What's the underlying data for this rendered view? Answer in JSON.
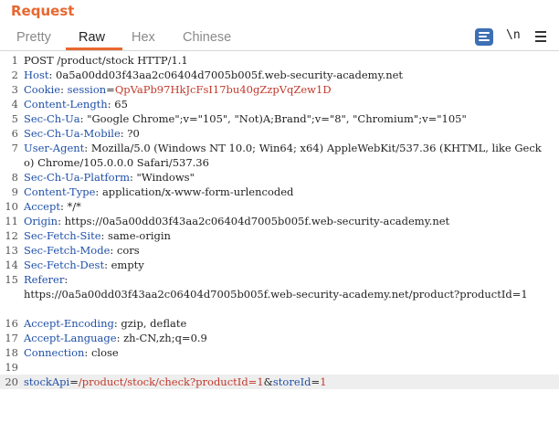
{
  "panel": {
    "title": "Request"
  },
  "tabs": [
    {
      "label": "Pretty",
      "active": false
    },
    {
      "label": "Raw",
      "active": true
    },
    {
      "label": "Hex",
      "active": false
    },
    {
      "label": "Chinese",
      "active": false
    }
  ],
  "toolbar": {
    "wrap_icon": "word-wrap-icon",
    "newline_label": "\\n",
    "menu_icon": "hamburger-menu-icon"
  },
  "colors": {
    "accent": "#e8672f",
    "header_name": "#1e4fa8",
    "cookie_value": "#c0392b",
    "button_blue": "#3d6fb5"
  },
  "request": {
    "request_line": "POST /product/stock HTTP/1.1",
    "headers": [
      {
        "name": "Host",
        "value": "0a5a00dd03f43aa2c06404d7005b005f.web-security-academy.net"
      },
      {
        "name": "Cookie",
        "value": ""
      },
      {
        "name": "Content-Length",
        "value": "65"
      },
      {
        "name": "Sec-Ch-Ua",
        "value": "\"Google Chrome\";v=\"105\", \"Not)A;Brand\";v=\"8\", \"Chromium\";v=\"105\""
      },
      {
        "name": "Sec-Ch-Ua-Mobile",
        "value": "?0"
      },
      {
        "name": "User-Agent",
        "value": "Mozilla/5.0 (Windows NT 10.0; Win64; x64) AppleWebKit/537.36 (KHTML, like Gecko) Chrome/105.0.0.0 Safari/537.36"
      },
      {
        "name": "Sec-Ch-Ua-Platform",
        "value": "\"Windows\""
      },
      {
        "name": "Content-Type",
        "value": "application/x-www-form-urlencoded"
      },
      {
        "name": "Accept",
        "value": "*/*"
      },
      {
        "name": "Origin",
        "value": "https://0a5a00dd03f43aa2c06404d7005b005f.web-security-academy.net"
      },
      {
        "name": "Sec-Fetch-Site",
        "value": "same-origin"
      },
      {
        "name": "Sec-Fetch-Mode",
        "value": "cors"
      },
      {
        "name": "Sec-Fetch-Dest",
        "value": "empty"
      },
      {
        "name": "Referer",
        "value": "https://0a5a00dd03f43aa2c06404d7005b005f.web-security-academy.net/product?productId=1"
      },
      {
        "name": "Accept-Encoding",
        "value": "gzip, deflate"
      },
      {
        "name": "Accept-Language",
        "value": "zh-CN,zh;q=0.9"
      },
      {
        "name": "Connection",
        "value": "close"
      }
    ],
    "cookie": {
      "name": "session",
      "value": "QpVaPb97HkJcFsI17bu40gZzpVqZew1D"
    },
    "body": {
      "param1_name": "stockApi",
      "param1_value": "/product/stock/check?productId=1",
      "param2_name": "storeId",
      "param2_value": "1"
    },
    "line_numbers": [
      "1",
      "2",
      "3",
      "4",
      "5",
      "6",
      "7",
      "8",
      "9",
      "10",
      "11",
      "12",
      "13",
      "14",
      "15",
      "16",
      "17",
      "18",
      "19",
      "20"
    ]
  }
}
